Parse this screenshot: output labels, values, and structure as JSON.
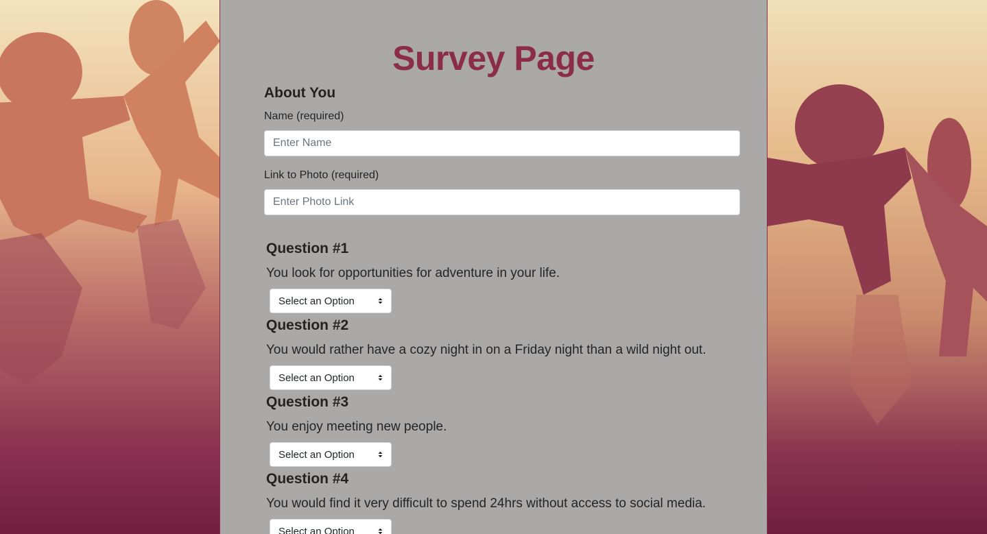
{
  "page": {
    "title": "Survey Page"
  },
  "about": {
    "heading": "About You",
    "name_label": "Name (required)",
    "name_placeholder": "Enter Name",
    "name_value": "",
    "photo_label": "Link to Photo (required)",
    "photo_placeholder": "Enter Photo Link",
    "photo_value": ""
  },
  "questions": [
    {
      "heading": "Question #1",
      "text": "You look for opportunities for adventure in your life.",
      "selected": "Select an Option"
    },
    {
      "heading": "Question #2",
      "text": "You would rather have a cozy night in on a Friday night than a wild night out.",
      "selected": "Select an Option"
    },
    {
      "heading": "Question #3",
      "text": "You enjoy meeting new people.",
      "selected": "Select an Option"
    },
    {
      "heading": "Question #4",
      "text": "You would find it very difficult to spend 24hrs without access to social media.",
      "selected": "Select an Option"
    }
  ],
  "colors": {
    "title": "#8b2c48",
    "panel": "#aaa9a7",
    "border": "#8a2f4c"
  },
  "icons": {
    "select_arrows": "up-down-chevron-icon",
    "background": "paper-people-chain-image"
  }
}
